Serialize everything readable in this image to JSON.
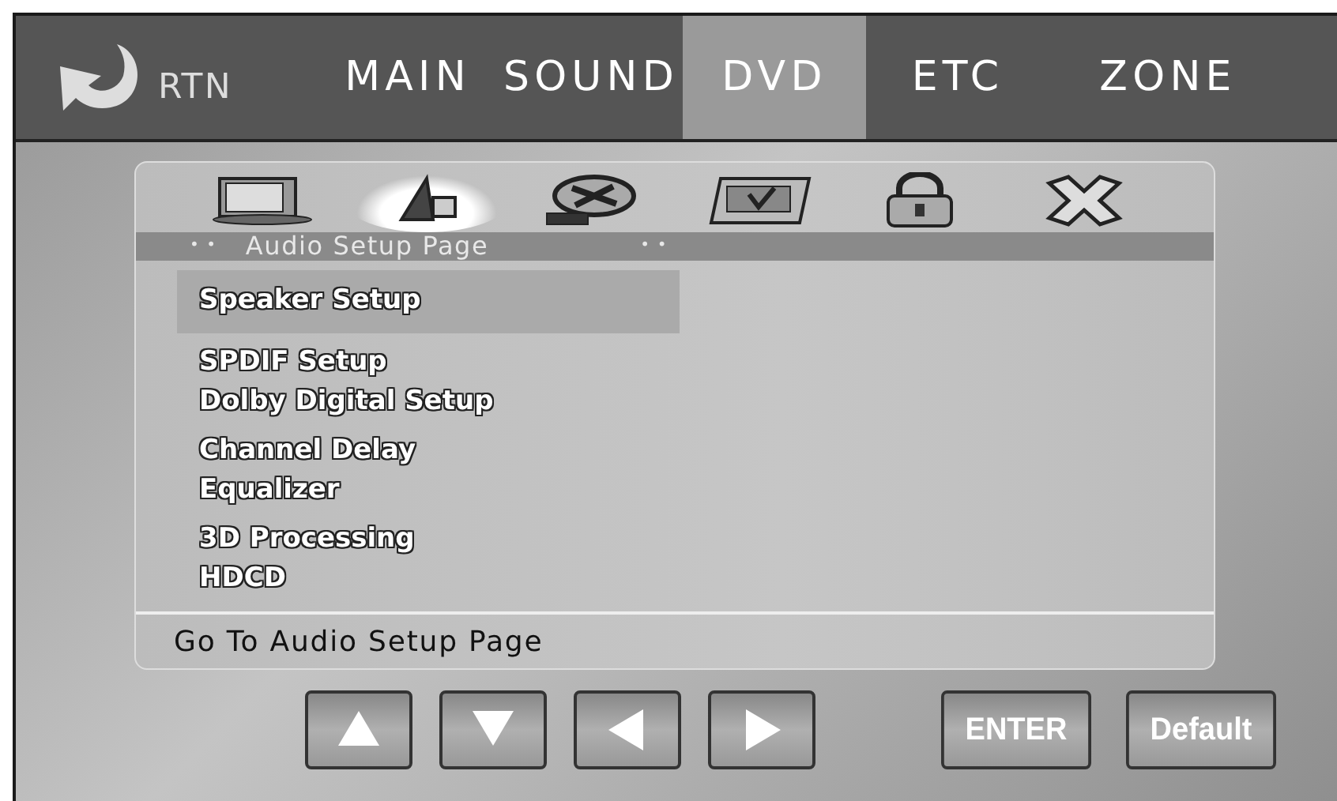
{
  "header": {
    "return_label": "RTN",
    "tabs": [
      {
        "label": "MAIN",
        "selected": false
      },
      {
        "label": "SOUND",
        "selected": false
      },
      {
        "label": "DVD",
        "selected": true
      },
      {
        "label": "ETC",
        "selected": false
      },
      {
        "label": "ZONE",
        "selected": false
      }
    ]
  },
  "setup_icons": [
    {
      "kind": "monitor",
      "selected": false
    },
    {
      "kind": "speaker",
      "selected": true
    },
    {
      "kind": "reel",
      "selected": false
    },
    {
      "kind": "panel",
      "selected": false
    },
    {
      "kind": "lock",
      "selected": false
    },
    {
      "kind": "exit",
      "selected": false
    }
  ],
  "page_title": {
    "lead": "• •",
    "title": "Audio Setup Page",
    "trail": "• •"
  },
  "menu_groups": [
    [
      {
        "label": "Speaker Setup",
        "selected": true
      }
    ],
    [
      {
        "label": "SPDIF Setup",
        "selected": false
      },
      {
        "label": "Dolby Digital Setup",
        "selected": false
      }
    ],
    [
      {
        "label": "Channel Delay",
        "selected": false
      },
      {
        "label": "Equalizer",
        "selected": false
      }
    ],
    [
      {
        "label": "3D Processing",
        "selected": false
      },
      {
        "label": "HDCD",
        "selected": false
      }
    ]
  ],
  "status": "Go To Audio Setup Page",
  "buttons": [
    {
      "kind": "up"
    },
    {
      "kind": "down"
    },
    {
      "kind": "left"
    },
    {
      "kind": "right"
    },
    {
      "kind": "text",
      "label": "ENTER"
    },
    {
      "kind": "text",
      "label": "Default"
    }
  ]
}
